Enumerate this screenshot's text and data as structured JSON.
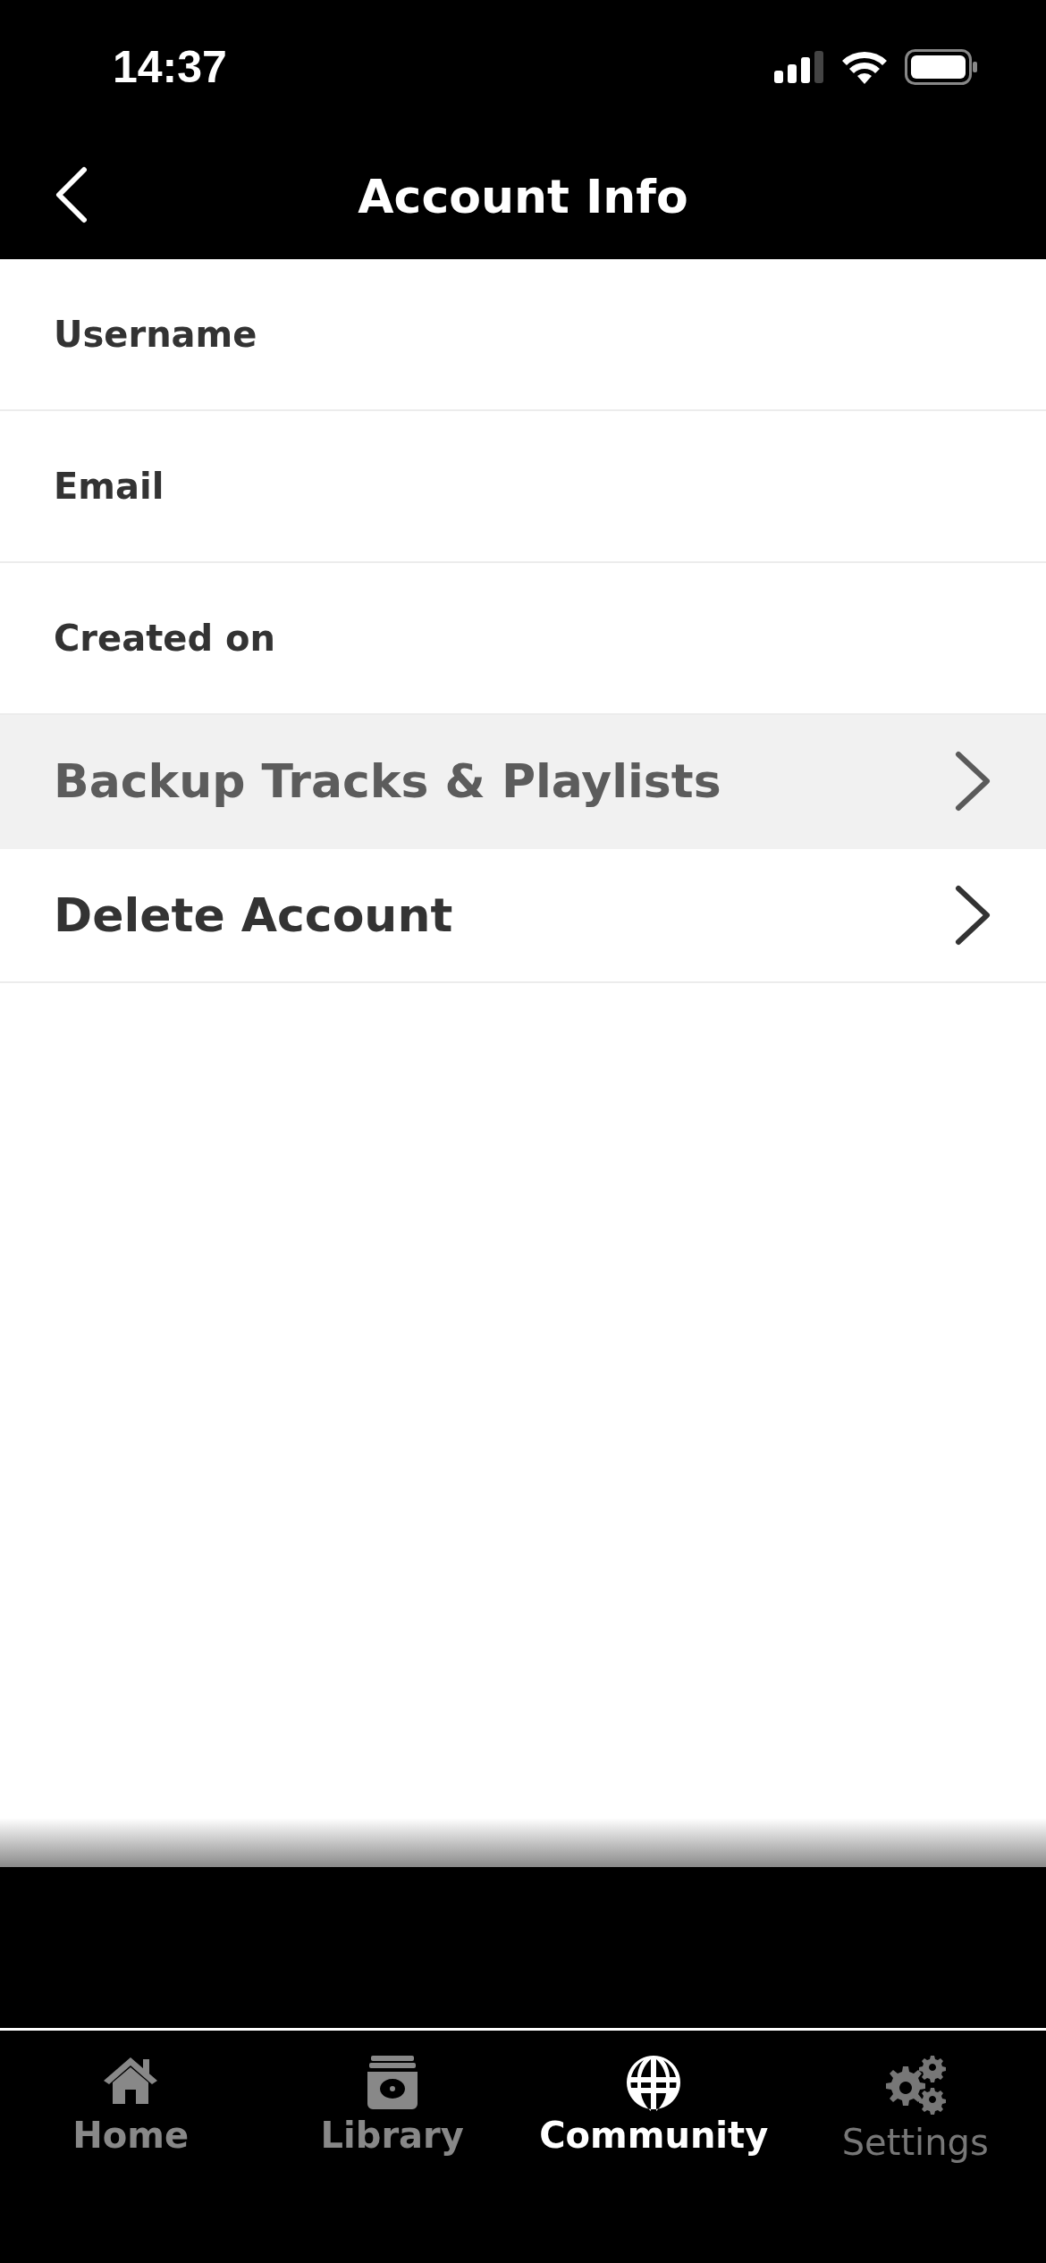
{
  "status_bar": {
    "time": "14:37"
  },
  "header": {
    "title": "Account Info"
  },
  "fields": [
    {
      "label": "Username"
    },
    {
      "label": "Email"
    },
    {
      "label": "Created on"
    }
  ],
  "actions": [
    {
      "label": "Backup Tracks & Playlists",
      "disabled": true
    },
    {
      "label": "Delete Account",
      "disabled": false
    }
  ],
  "tabs": [
    {
      "label": "Home",
      "kind": "home",
      "selected": false,
      "disabled": false
    },
    {
      "label": "Library",
      "kind": "library",
      "selected": false,
      "disabled": false
    },
    {
      "label": "Community",
      "kind": "community",
      "selected": true,
      "disabled": false
    },
    {
      "label": "Settings",
      "kind": "settings",
      "selected": false,
      "disabled": true
    }
  ]
}
